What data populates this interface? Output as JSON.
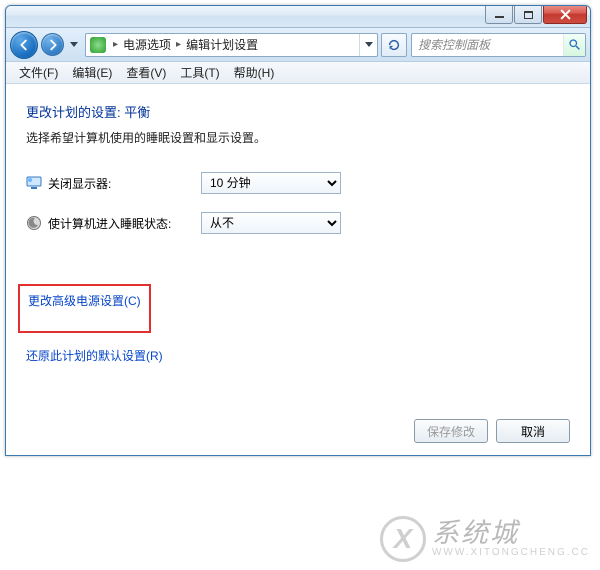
{
  "breadcrumb": {
    "item1": "电源选项",
    "item2": "编辑计划设置"
  },
  "search": {
    "placeholder": "搜索控制面板"
  },
  "menu": {
    "file": "文件(F)",
    "edit": "编辑(E)",
    "view": "查看(V)",
    "tools": "工具(T)",
    "help": "帮助(H)"
  },
  "page": {
    "title": "更改计划的设置: 平衡",
    "desc": "选择希望计算机使用的睡眠设置和显示设置。"
  },
  "rows": {
    "display_off": {
      "label": "关闭显示器:",
      "value": "10 分钟"
    },
    "sleep": {
      "label": "使计算机进入睡眠状态:",
      "value": "从不"
    }
  },
  "links": {
    "advanced": "更改高级电源设置(C)",
    "restore": "还原此计划的默认设置(R)"
  },
  "buttons": {
    "save": "保存修改",
    "cancel": "取消"
  },
  "watermark": {
    "big": "系统城",
    "small": "WWW.XITONGCHENG.CC"
  }
}
